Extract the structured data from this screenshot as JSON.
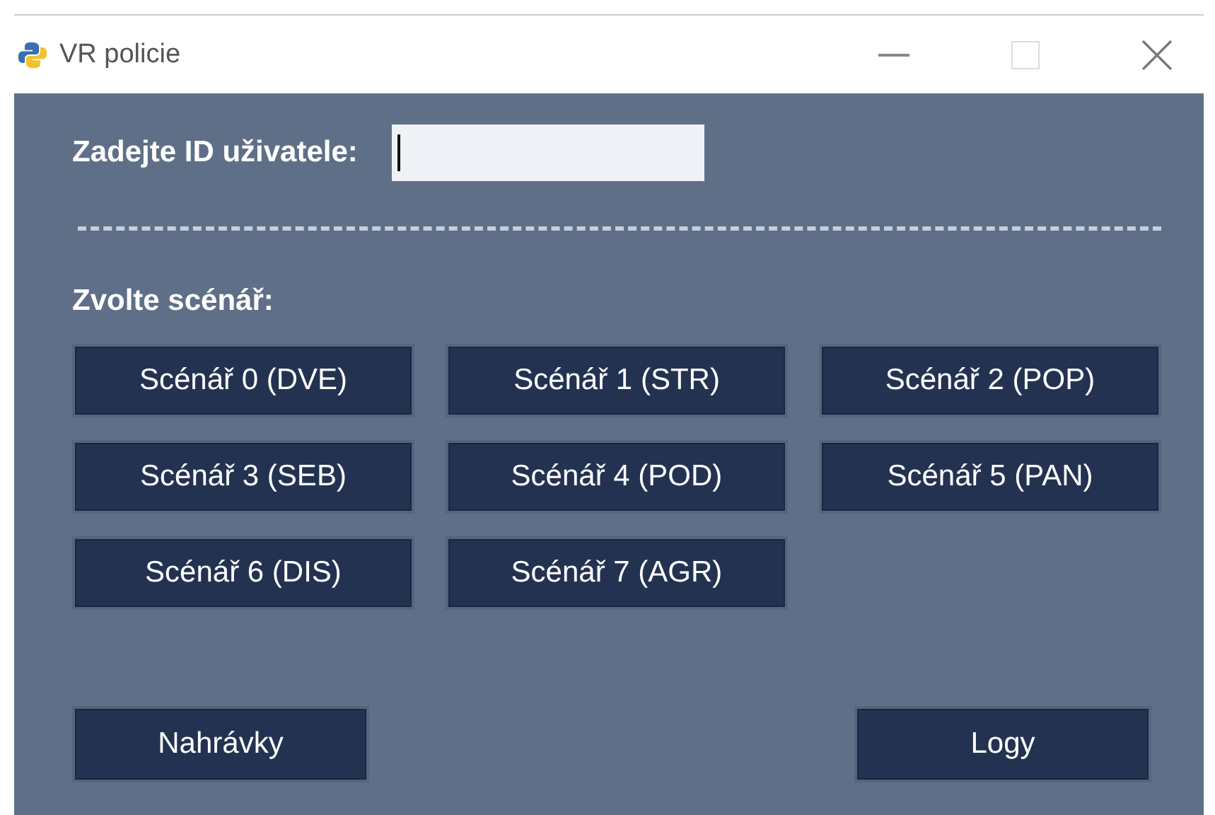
{
  "window": {
    "title": "VR policie"
  },
  "user_id": {
    "label": "Zadejte ID uživatele:",
    "focused": true
  },
  "scenario_label": "Zvolte scénář:",
  "scenarios": [
    "Scénář 0 (DVE)",
    "Scénář 1 (STR)",
    "Scénář 2 (POP)",
    "Scénář 3 (SEB)",
    "Scénář 4 (POD)",
    "Scénář 5 (PAN)",
    "Scénář 6 (DIS)",
    "Scénář 7 (AGR)"
  ],
  "bottom_buttons": [
    "Nahrávky",
    "Logy"
  ]
}
